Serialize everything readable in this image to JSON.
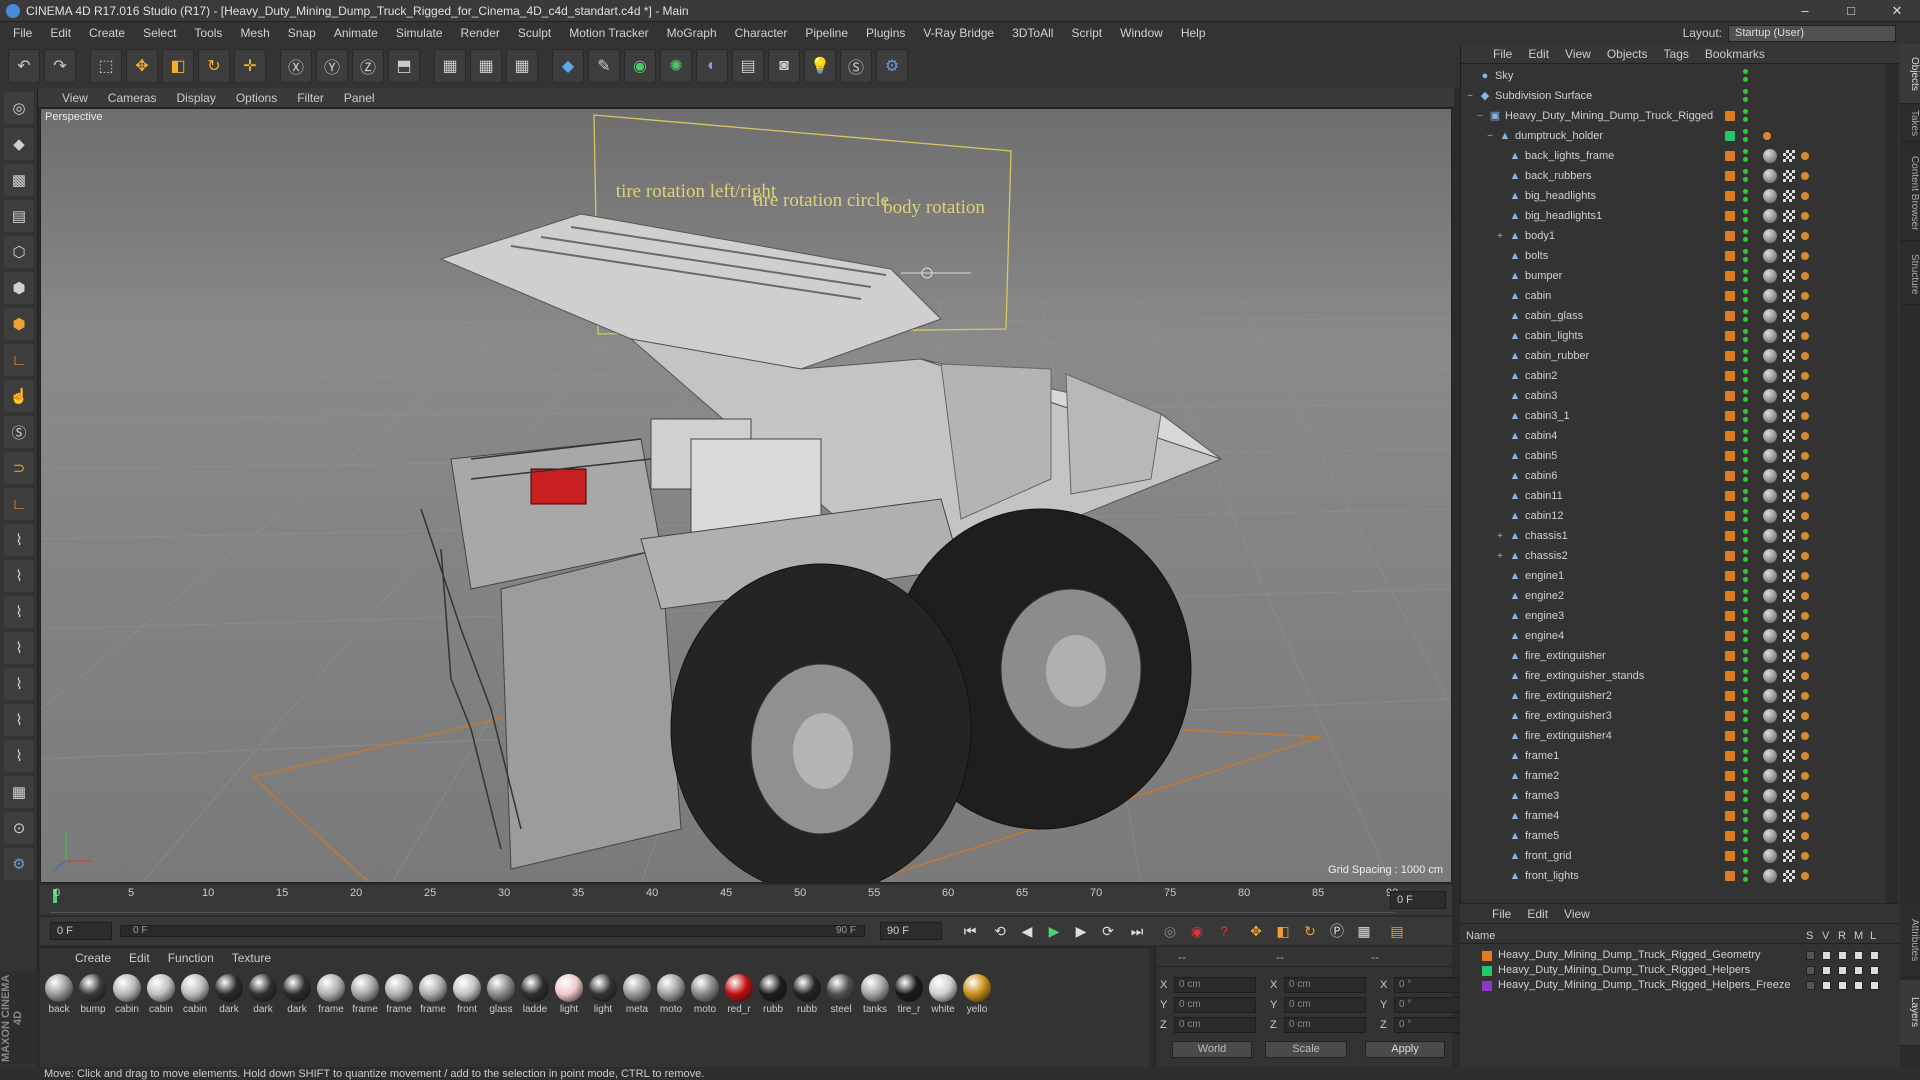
{
  "window": {
    "title": "CINEMA 4D R17.016 Studio (R17) - [Heavy_Duty_Mining_Dump_Truck_Rigged_for_Cinema_4D_c4d_standart.c4d *] - Main",
    "minimize": "–",
    "maximize": "□",
    "close": "✕"
  },
  "menu": [
    "File",
    "Edit",
    "Create",
    "Select",
    "Tools",
    "Mesh",
    "Snap",
    "Animate",
    "Simulate",
    "Render",
    "Sculpt",
    "Motion Tracker",
    "MoGraph",
    "Character",
    "Pipeline",
    "Plugins",
    "V-Ray Bridge",
    "3DToAll",
    "Script",
    "Window",
    "Help"
  ],
  "layout": {
    "label": "Layout:",
    "value": "Startup (User)"
  },
  "viewport": {
    "menu": [
      "View",
      "Cameras",
      "Display",
      "Options",
      "Filter",
      "Panel"
    ],
    "label": "Perspective",
    "grid_spacing": "Grid Spacing : 1000 cm",
    "rig_labels": [
      "tire rotation left/right",
      "tire rotation circle",
      "body rotation"
    ]
  },
  "timeline": {
    "ticks": [
      "0",
      "5",
      "10",
      "15",
      "20",
      "25",
      "30",
      "35",
      "40",
      "45",
      "50",
      "55",
      "60",
      "65",
      "70",
      "75",
      "80",
      "85",
      "90"
    ],
    "current_frame": "0 F",
    "start_field": "0 F",
    "range_start": "0 F",
    "range_end": "90 F",
    "end_field": "90 F"
  },
  "materials": {
    "menu": [
      "Create",
      "Edit",
      "Function",
      "Texture"
    ],
    "items": [
      {
        "name": "back",
        "color": "#9a9a9a"
      },
      {
        "name": "bump",
        "color": "#3a3a3a"
      },
      {
        "name": "cabin",
        "color": "#b8b8b8"
      },
      {
        "name": "cabin",
        "color": "#c0c0c0"
      },
      {
        "name": "cabin",
        "color": "#bcbcbc"
      },
      {
        "name": "dark",
        "color": "#2a2a2a"
      },
      {
        "name": "dark",
        "color": "#303030"
      },
      {
        "name": "dark",
        "color": "#2c2c2c"
      },
      {
        "name": "frame",
        "color": "#b0b0b0"
      },
      {
        "name": "frame",
        "color": "#a8a8a8"
      },
      {
        "name": "frame",
        "color": "#b4b4b4"
      },
      {
        "name": "frame",
        "color": "#aeaeae"
      },
      {
        "name": "front",
        "color": "#c4c4c4"
      },
      {
        "name": "glass",
        "color": "#8a8a8a"
      },
      {
        "name": "ladde",
        "color": "#2e2e2e"
      },
      {
        "name": "light",
        "color": "#f0c8c8"
      },
      {
        "name": "light",
        "color": "#333333"
      },
      {
        "name": "meta",
        "color": "#999999"
      },
      {
        "name": "moto",
        "color": "#a0a0a0"
      },
      {
        "name": "moto",
        "color": "#888888"
      },
      {
        "name": "red_r",
        "color": "#c01010"
      },
      {
        "name": "rubb",
        "color": "#1c1c1c"
      },
      {
        "name": "rubb",
        "color": "#242424"
      },
      {
        "name": "steel",
        "color": "#505050"
      },
      {
        "name": "tanks",
        "color": "#a4a4a4"
      },
      {
        "name": "tire_r",
        "color": "#1a1a1a"
      },
      {
        "name": "white",
        "color": "#d0d0d0"
      },
      {
        "name": "yello",
        "color": "#c89018"
      }
    ]
  },
  "coords": {
    "header": [
      "--",
      "--",
      "--"
    ],
    "rows": [
      {
        "axis": "X",
        "pos": "0 cm",
        "axis2": "X",
        "size": "0 cm",
        "axis3": "X",
        "rot": "0 °"
      },
      {
        "axis": "Y",
        "pos": "0 cm",
        "axis2": "Y",
        "size": "0 cm",
        "axis3": "Y",
        "rot": "0 °"
      },
      {
        "axis": "Z",
        "pos": "0 cm",
        "axis2": "Z",
        "size": "0 cm",
        "axis3": "Z",
        "rot": "0 °"
      }
    ],
    "mode": "World",
    "scale": "Scale",
    "apply": "Apply"
  },
  "status": "Move: Click and drag to move elements. Hold down SHIFT to quantize movement / add to the selection in point mode, CTRL to remove.",
  "objects": {
    "menu": [
      "File",
      "Edit",
      "View",
      "Objects",
      "Tags",
      "Bookmarks"
    ],
    "rows": [
      {
        "name": "Sky",
        "indent": 0,
        "exp": "",
        "icon": "●",
        "layer": false
      },
      {
        "name": "Subdivision Surface",
        "indent": 0,
        "exp": "−",
        "icon": "◆",
        "layer": false
      },
      {
        "name": "Heavy_Duty_Mining_Dump_Truck_Rigged",
        "indent": 1,
        "exp": "−",
        "icon": "▣",
        "layer": true
      },
      {
        "name": "dumptruck_holder",
        "indent": 2,
        "exp": "−",
        "icon": "▲",
        "layer": true
      },
      {
        "name": "back_lights_frame",
        "indent": 3,
        "exp": "",
        "icon": "▲",
        "layer": true
      },
      {
        "name": "back_rubbers",
        "indent": 3,
        "exp": "",
        "icon": "▲",
        "layer": true
      },
      {
        "name": "big_headlights",
        "indent": 3,
        "exp": "",
        "icon": "▲",
        "layer": true
      },
      {
        "name": "big_headlights1",
        "indent": 3,
        "exp": "",
        "icon": "▲",
        "layer": true
      },
      {
        "name": "body1",
        "indent": 3,
        "exp": "+",
        "icon": "▲",
        "layer": true
      },
      {
        "name": "bolts",
        "indent": 3,
        "exp": "",
        "icon": "▲",
        "layer": true
      },
      {
        "name": "bumper",
        "indent": 3,
        "exp": "",
        "icon": "▲",
        "layer": true
      },
      {
        "name": "cabin",
        "indent": 3,
        "exp": "",
        "icon": "▲",
        "layer": true
      },
      {
        "name": "cabin_glass",
        "indent": 3,
        "exp": "",
        "icon": "▲",
        "layer": true
      },
      {
        "name": "cabin_lights",
        "indent": 3,
        "exp": "",
        "icon": "▲",
        "layer": true
      },
      {
        "name": "cabin_rubber",
        "indent": 3,
        "exp": "",
        "icon": "▲",
        "layer": true
      },
      {
        "name": "cabin2",
        "indent": 3,
        "exp": "",
        "icon": "▲",
        "layer": true
      },
      {
        "name": "cabin3",
        "indent": 3,
        "exp": "",
        "icon": "▲",
        "layer": true
      },
      {
        "name": "cabin3_1",
        "indent": 3,
        "exp": "",
        "icon": "▲",
        "layer": true
      },
      {
        "name": "cabin4",
        "indent": 3,
        "exp": "",
        "icon": "▲",
        "layer": true
      },
      {
        "name": "cabin5",
        "indent": 3,
        "exp": "",
        "icon": "▲",
        "layer": true
      },
      {
        "name": "cabin6",
        "indent": 3,
        "exp": "",
        "icon": "▲",
        "layer": true
      },
      {
        "name": "cabin11",
        "indent": 3,
        "exp": "",
        "icon": "▲",
        "layer": true
      },
      {
        "name": "cabin12",
        "indent": 3,
        "exp": "",
        "icon": "▲",
        "layer": true
      },
      {
        "name": "chassis1",
        "indent": 3,
        "exp": "+",
        "icon": "▲",
        "layer": true
      },
      {
        "name": "chassis2",
        "indent": 3,
        "exp": "+",
        "icon": "▲",
        "layer": true
      },
      {
        "name": "engine1",
        "indent": 3,
        "exp": "",
        "icon": "▲",
        "layer": true
      },
      {
        "name": "engine2",
        "indent": 3,
        "exp": "",
        "icon": "▲",
        "layer": true
      },
      {
        "name": "engine3",
        "indent": 3,
        "exp": "",
        "icon": "▲",
        "layer": true
      },
      {
        "name": "engine4",
        "indent": 3,
        "exp": "",
        "icon": "▲",
        "layer": true
      },
      {
        "name": "fire_extinguisher",
        "indent": 3,
        "exp": "",
        "icon": "▲",
        "layer": true
      },
      {
        "name": "fire_extinguisher_stands",
        "indent": 3,
        "exp": "",
        "icon": "▲",
        "layer": true
      },
      {
        "name": "fire_extinguisher2",
        "indent": 3,
        "exp": "",
        "icon": "▲",
        "layer": true
      },
      {
        "name": "fire_extinguisher3",
        "indent": 3,
        "exp": "",
        "icon": "▲",
        "layer": true
      },
      {
        "name": "fire_extinguisher4",
        "indent": 3,
        "exp": "",
        "icon": "▲",
        "layer": true
      },
      {
        "name": "frame1",
        "indent": 3,
        "exp": "",
        "icon": "▲",
        "layer": true
      },
      {
        "name": "frame2",
        "indent": 3,
        "exp": "",
        "icon": "▲",
        "layer": true
      },
      {
        "name": "frame3",
        "indent": 3,
        "exp": "",
        "icon": "▲",
        "layer": true
      },
      {
        "name": "frame4",
        "indent": 3,
        "exp": "",
        "icon": "▲",
        "layer": true
      },
      {
        "name": "frame5",
        "indent": 3,
        "exp": "",
        "icon": "▲",
        "layer": true
      },
      {
        "name": "front_grid",
        "indent": 3,
        "exp": "",
        "icon": "▲",
        "layer": true
      },
      {
        "name": "front_lights",
        "indent": 3,
        "exp": "",
        "icon": "▲",
        "layer": true
      }
    ]
  },
  "layers": {
    "menu": [
      "File",
      "Edit",
      "View"
    ],
    "header": {
      "name": "Name",
      "cols": [
        "S",
        "V",
        "R",
        "M",
        "L"
      ]
    },
    "rows": [
      {
        "name": "Heavy_Duty_Mining_Dump_Truck_Rigged_Geometry",
        "color": "#e07b20"
      },
      {
        "name": "Heavy_Duty_Mining_Dump_Truck_Rigged_Helpers",
        "color": "#22c86a"
      },
      {
        "name": "Heavy_Duty_Mining_Dump_Truck_Rigged_Helpers_Freeze",
        "color": "#8a3ac8"
      }
    ]
  },
  "side_tabs": [
    "Objects",
    "Takes",
    "Content Browser",
    "Structure"
  ],
  "side_tabs2": [
    "Attributes",
    "Layers"
  ],
  "brand": "MAXON CINEMA 4D"
}
